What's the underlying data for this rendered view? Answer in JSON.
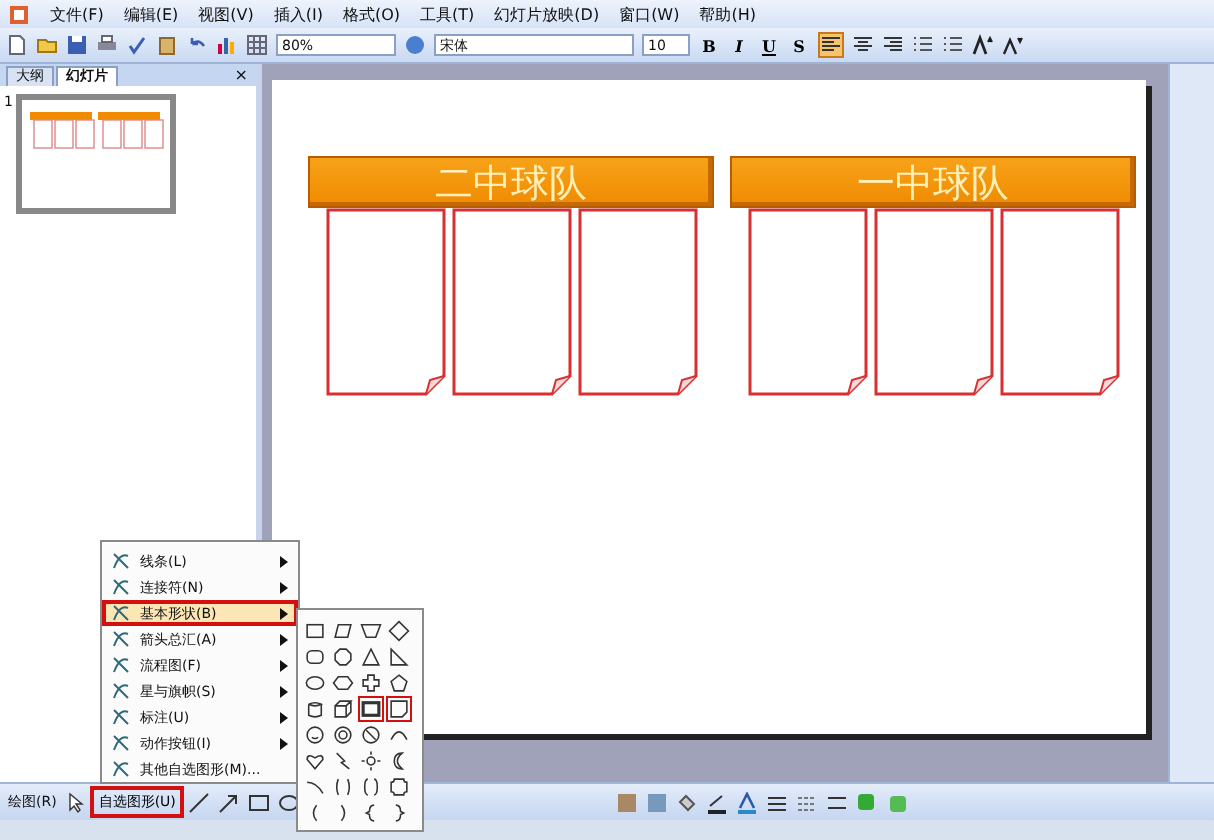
{
  "menu_bar": [
    "文件(F)",
    "编辑(E)",
    "视图(V)",
    "插入(I)",
    "格式(O)",
    "工具(T)",
    "幻灯片放映(D)",
    "窗口(W)",
    "帮助(H)"
  ],
  "toolbar": {
    "zoom": "80%",
    "font": "宋体",
    "font_size": "10",
    "format_buttons": [
      "B",
      "I",
      "U",
      "S"
    ]
  },
  "side_panel": {
    "tabs": [
      {
        "label": "大纲",
        "selected": false
      },
      {
        "label": "幻灯片",
        "selected": true
      }
    ],
    "close": "×",
    "slide_number": "1"
  },
  "slide": {
    "teams": [
      {
        "title": "二中球队"
      },
      {
        "title": "一中球队"
      }
    ]
  },
  "autoshape_menu": {
    "items": [
      {
        "label": "线条(L)",
        "highlighted": false,
        "submenu": true
      },
      {
        "label": "连接符(N)",
        "highlighted": false,
        "submenu": true
      },
      {
        "label": "基本形状(B)",
        "highlighted": true,
        "submenu": true
      },
      {
        "label": "箭头总汇(A)",
        "highlighted": false,
        "submenu": true
      },
      {
        "label": "流程图(F)",
        "highlighted": false,
        "submenu": true
      },
      {
        "label": "星与旗帜(S)",
        "highlighted": false,
        "submenu": true
      },
      {
        "label": "标注(U)",
        "highlighted": false,
        "submenu": true
      },
      {
        "label": "动作按钮(I)",
        "highlighted": false,
        "submenu": true
      },
      {
        "label": "其他自选图形(M)...",
        "highlighted": false,
        "submenu": false
      }
    ]
  },
  "shapes_palette": [
    {
      "kind": "rectangle",
      "highlighted": false
    },
    {
      "kind": "parallelogram",
      "highlighted": false
    },
    {
      "kind": "trapezoid",
      "highlighted": false
    },
    {
      "kind": "diamond",
      "highlighted": false
    },
    {
      "kind": "rounded",
      "highlighted": false
    },
    {
      "kind": "octagon",
      "highlighted": false
    },
    {
      "kind": "triangle",
      "highlighted": false
    },
    {
      "kind": "right-triangle",
      "highlighted": false
    },
    {
      "kind": "oval",
      "highlighted": false
    },
    {
      "kind": "hexagon",
      "highlighted": false
    },
    {
      "kind": "cross",
      "highlighted": false
    },
    {
      "kind": "pentagon",
      "highlighted": false
    },
    {
      "kind": "can",
      "highlighted": false
    },
    {
      "kind": "cube",
      "highlighted": false
    },
    {
      "kind": "frame",
      "highlighted": true
    },
    {
      "kind": "folded",
      "highlighted": true
    },
    {
      "kind": "smiley",
      "highlighted": false
    },
    {
      "kind": "donut",
      "highlighted": false
    },
    {
      "kind": "no-symbol",
      "highlighted": false
    },
    {
      "kind": "arc",
      "highlighted": false
    },
    {
      "kind": "heart",
      "highlighted": false
    },
    {
      "kind": "lightning",
      "highlighted": false
    },
    {
      "kind": "sun",
      "highlighted": false
    },
    {
      "kind": "moon",
      "highlighted": false
    },
    {
      "kind": "curve",
      "highlighted": false
    },
    {
      "kind": "bracket-pair",
      "highlighted": false
    },
    {
      "kind": "brace-pair",
      "highlighted": false
    },
    {
      "kind": "plaque",
      "highlighted": false
    },
    {
      "kind": "left-bracket",
      "highlighted": false
    },
    {
      "kind": "right-bracket",
      "highlighted": false
    },
    {
      "kind": "left-brace",
      "highlighted": false
    },
    {
      "kind": "right-brace",
      "highlighted": false
    }
  ],
  "drawing_toolbar": {
    "draw_menu": "绘图(R)",
    "autoshapes": {
      "label": "自选图形(U)",
      "highlighted": true
    }
  }
}
